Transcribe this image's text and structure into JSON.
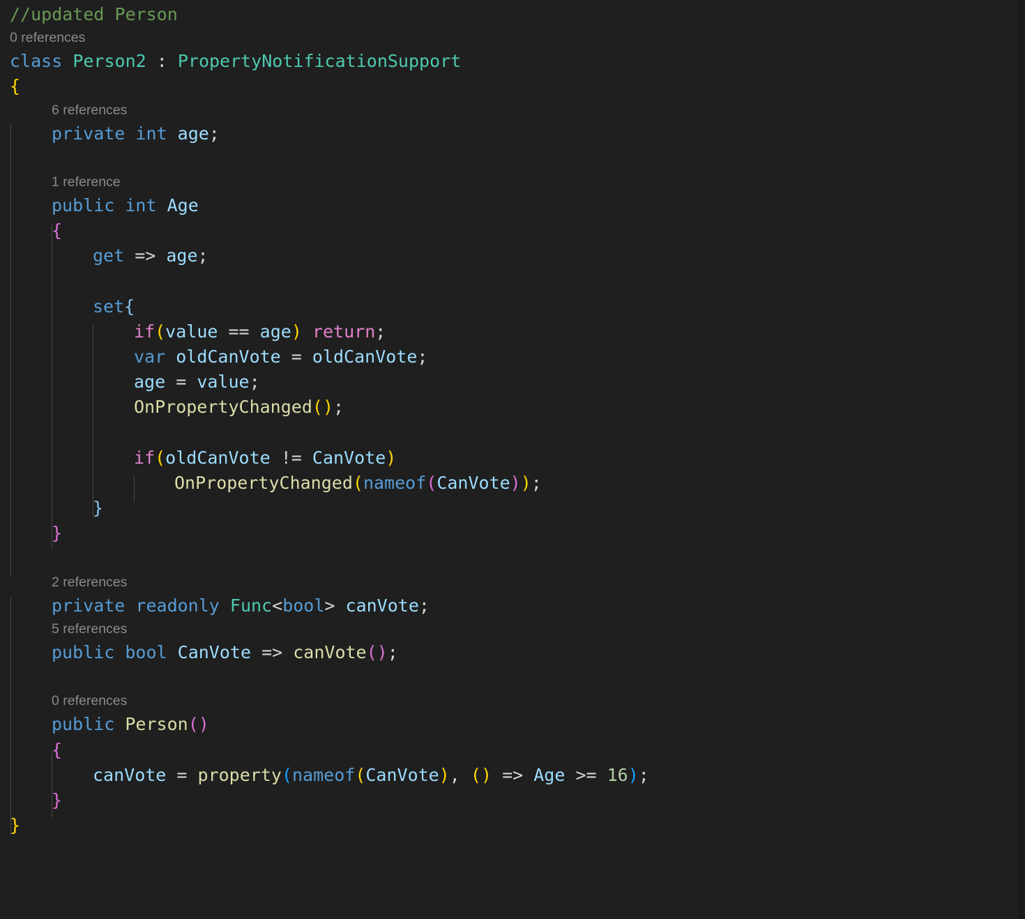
{
  "editor": {
    "language": "csharp",
    "background_color": "#1f1f1f",
    "font_size_px": 25,
    "colors": {
      "comment": "#6a9955",
      "keyword": "#569cd6",
      "type": "#4ec9b0",
      "identifier": "#9cdcfe",
      "control_keyword": "#df80c8",
      "function": "#dcdcaa",
      "number": "#b5cea8",
      "operator": "#d4d4d4",
      "codelens": "#8a8a8a",
      "bracket_level_1": "#ffd700",
      "bracket_level_2": "#da70d6",
      "bracket_level_3": "#179fff",
      "indent_guide": "#474747"
    }
  },
  "codelens": {
    "class_person2": "0 references",
    "field_age": "6 references",
    "property_age": "1 reference",
    "field_can_vote": "2 references",
    "property_can_vote": "5 references",
    "ctor_person": "0 references"
  },
  "code": {
    "comment_header": "//updated Person",
    "class_keyword": "class",
    "class_name": "Person2",
    "class_colon": " : ",
    "base_type": "PropertyNotificationSupport",
    "brace_open_class": "{",
    "brace_close_class": "}",
    "field_age": {
      "modifier": "private",
      "type": "int",
      "name": "age",
      "semicolon": ";"
    },
    "property_age": {
      "modifier": "public",
      "type": "int",
      "name": "Age",
      "brace_open": "{",
      "brace_close": "}",
      "getter": {
        "keyword": "get",
        "arrow": " => ",
        "value": "age",
        "semicolon": ";"
      },
      "setter": {
        "keyword": "set",
        "brace_open": "{",
        "brace_close": "}",
        "guard_if": "if",
        "guard_paren_open": "(",
        "guard_left": "value",
        "guard_op": " == ",
        "guard_right": "age",
        "guard_paren_close": ")",
        "guard_return": "return",
        "guard_semicolon": ";",
        "var_keyword": "var",
        "var_name": "oldCanVote",
        "var_assign": " = ",
        "var_value": "oldCanVote",
        "var_semicolon": ";",
        "assign_target": "age",
        "assign_op": " = ",
        "assign_value": "value",
        "assign_semicolon": ";",
        "notify_call": "OnPropertyChanged",
        "notify_paren_open": "(",
        "notify_paren_close": ")",
        "notify_semicolon": ";",
        "check_if": "if",
        "check_paren_open": "(",
        "check_left": "oldCanVote",
        "check_op": " != ",
        "check_right": "CanVote",
        "check_paren_close": ")",
        "notify2_call": "OnPropertyChanged",
        "notify2_paren_open": "(",
        "notify2_nameof": "nameof",
        "notify2_inner_open": "(",
        "notify2_arg": "CanVote",
        "notify2_inner_close": ")",
        "notify2_paren_close": ")",
        "notify2_semicolon": ";"
      }
    },
    "field_can_vote": {
      "modifier": "private",
      "readonly": "readonly",
      "type": "Func",
      "generic_open": "<",
      "generic_arg": "bool",
      "generic_close": ">",
      "name": "canVote",
      "semicolon": ";"
    },
    "property_can_vote": {
      "modifier": "public",
      "type": "bool",
      "name": "CanVote",
      "arrow": " => ",
      "body_call": "canVote",
      "paren_open": "(",
      "paren_close": ")",
      "semicolon": ";"
    },
    "constructor": {
      "modifier": "public",
      "name": "Person",
      "paren_open": "(",
      "paren_close": ")",
      "brace_open": "{",
      "brace_close": "}",
      "body": {
        "target": "canVote",
        "assign": " = ",
        "call": "property",
        "paren_open": "(",
        "nameof": "nameof",
        "inner_open": "(",
        "inner_arg": "CanVote",
        "inner_close": ")",
        "comma": ", ",
        "lambda_paren_open": "(",
        "lambda_paren_close": ")",
        "lambda_arrow": " => ",
        "lambda_left": "Age",
        "lambda_op": " >= ",
        "lambda_number": "16",
        "paren_close": ")",
        "semicolon": ";"
      }
    }
  }
}
